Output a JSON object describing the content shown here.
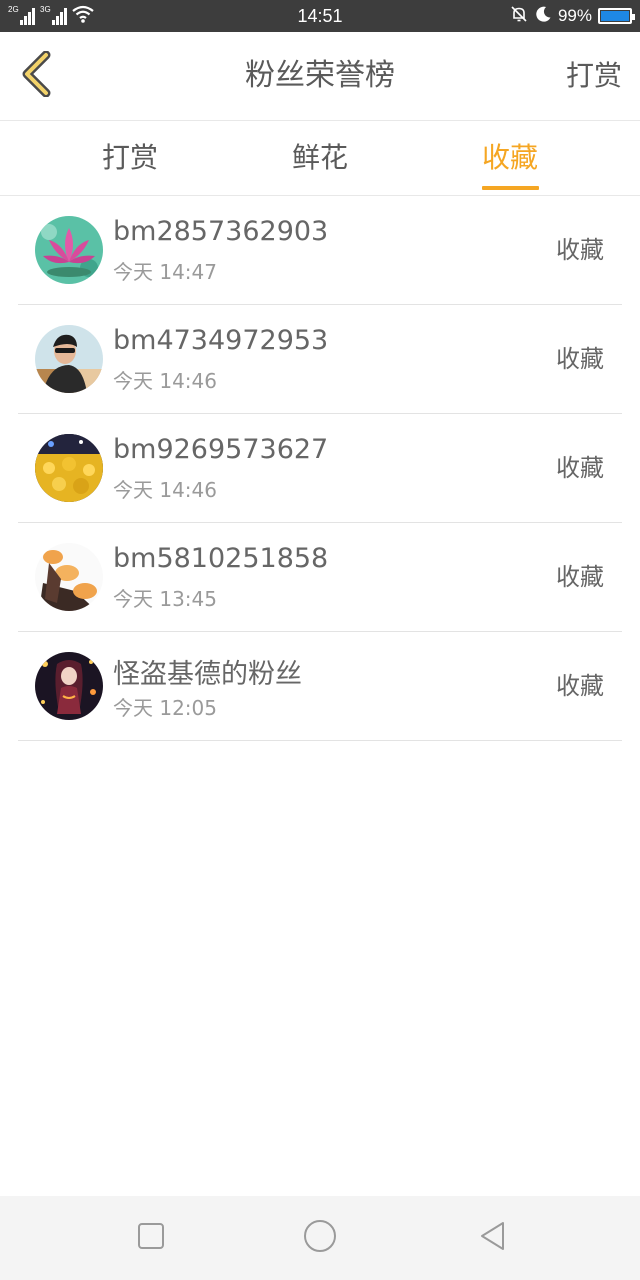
{
  "status_bar": {
    "network_1": "2G",
    "network_2": "3G",
    "time": "14:51",
    "battery": "99%",
    "battery_level": 0.99,
    "icons": [
      "signal-icon",
      "wifi-icon",
      "mute-bell-icon",
      "moon-icon",
      "battery-icon"
    ]
  },
  "header": {
    "back_icon": "chevron-left-icon",
    "title": "粉丝荣誉榜",
    "right_action": "打赏"
  },
  "tabs": [
    {
      "label": "打赏",
      "active": false
    },
    {
      "label": "鲜花",
      "active": false
    },
    {
      "label": "收藏",
      "active": true
    }
  ],
  "fans": [
    {
      "name": "bm2857362903",
      "time": "今天 14:47",
      "action": "收藏"
    },
    {
      "name": "bm4734972953",
      "time": "今天 14:46",
      "action": "收藏"
    },
    {
      "name": "bm9269573627",
      "time": "今天 14:46",
      "action": "收藏"
    },
    {
      "name": "bm5810251858",
      "time": "今天 13:45",
      "action": "收藏"
    },
    {
      "name": "怪盗基德的粉丝",
      "time": "今天 12:05",
      "action": "收藏"
    }
  ],
  "colors": {
    "accent": "#f5a623",
    "status_bar": "#3d3d3d",
    "text": "#666666",
    "subtext": "#9a9a9a"
  },
  "nav_bar": {
    "icons": [
      "recent-apps-icon",
      "home-icon",
      "back-triangle-icon"
    ]
  }
}
